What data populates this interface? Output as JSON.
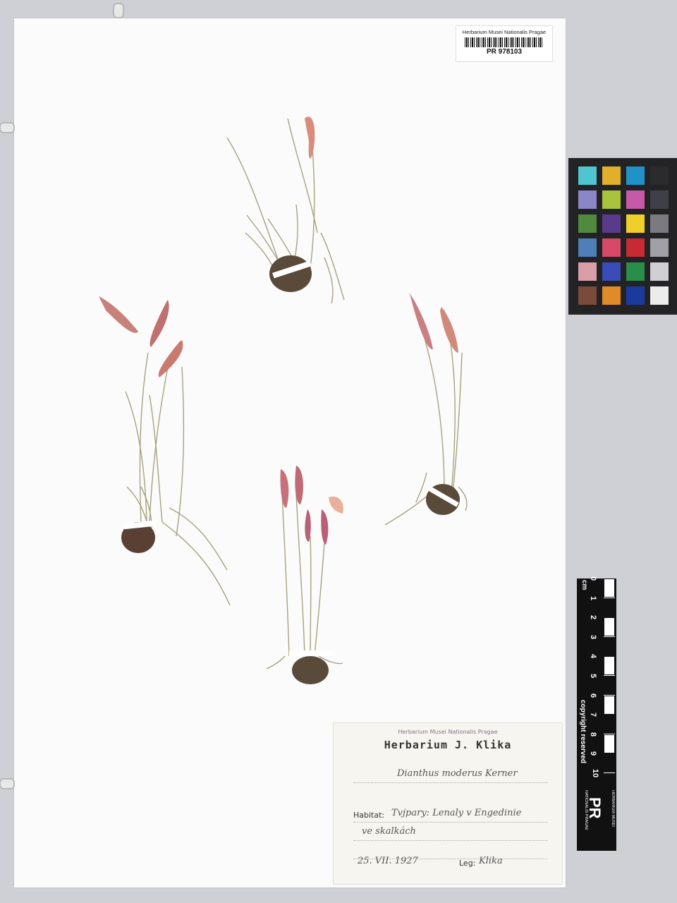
{
  "barcode_label": {
    "institution": "Herbarium Musei Nationalis Pragae",
    "specimen_number": "PR 978103"
  },
  "scale_bar": {
    "unit": "cm",
    "marks": [
      "0",
      "1",
      "2",
      "3",
      "4",
      "5",
      "6",
      "7",
      "8",
      "9",
      "10"
    ],
    "copyright": "copyright reserved",
    "logo": "PR",
    "herbarium_line": "HERBARIUM MUSEI",
    "nationalis_line": "NATIONALIS PRAGAE"
  },
  "color_chart": {
    "swatches": [
      "#4fc6cf",
      "#e0b02a",
      "#1f93c8",
      "#2b2b2e",
      "#8a86c8",
      "#a9c43c",
      "#c65aa8",
      "#3f4046",
      "#4f8a3e",
      "#5a3a8a",
      "#f0cf2a",
      "#7a7a80",
      "#4f7fb6",
      "#d64a68",
      "#c82a34",
      "#a0a0a6",
      "#d8a0a6",
      "#3a4cb6",
      "#2a8e4a",
      "#d0d0d4",
      "#7a4a3a",
      "#e08a2a",
      "#1a3aa0",
      "#ececec"
    ]
  },
  "specimen_label": {
    "stamp": "Herbarium Musei Nationalis Pragae",
    "title": "Herbarium J. Klika",
    "taxon": "Dianthus moderus Kerner",
    "habitat_label": "Habitat:",
    "habitat_line1": "Tvjpary: Lenaly v Engedinie",
    "habitat_line2": "ve skalkách",
    "date": "25. VII. 1927",
    "leg_label": "Leg:",
    "collector": "Klika"
  }
}
